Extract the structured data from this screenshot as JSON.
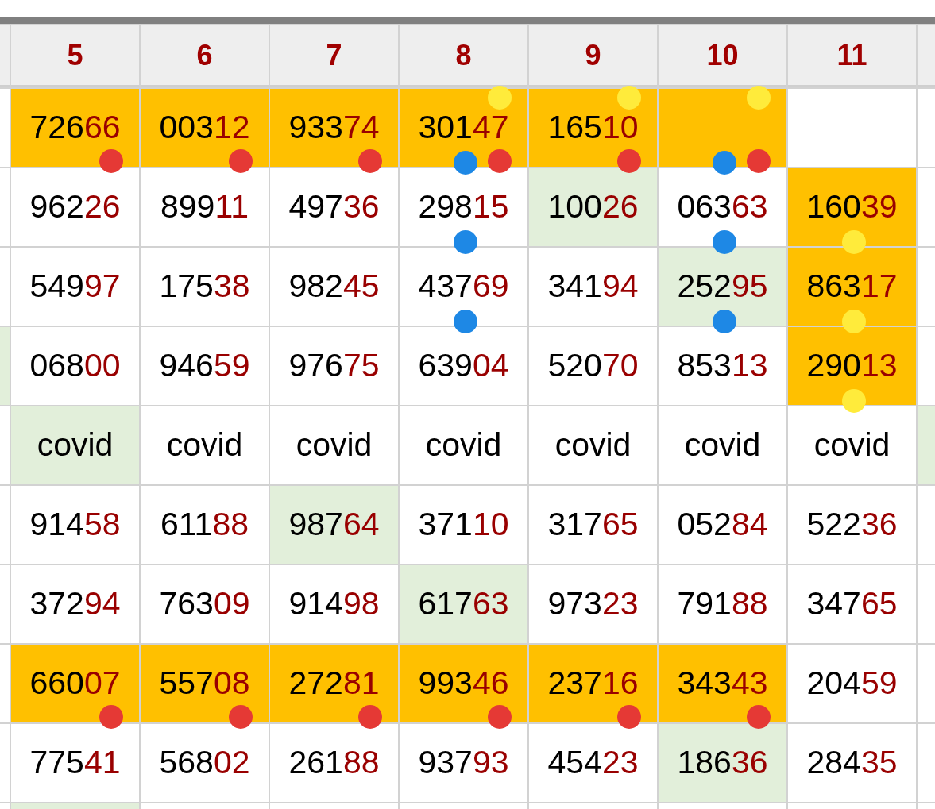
{
  "header": [
    {
      "label": "5"
    },
    {
      "label": "6"
    },
    {
      "label": "7"
    },
    {
      "label": "8"
    },
    {
      "label": "9"
    },
    {
      "label": "10"
    },
    {
      "label": "11"
    }
  ],
  "rows": [
    {
      "kind": "numbers",
      "cells": [
        {},
        {
          "text": "72666",
          "color": "#ffc000",
          "dots": [
            {
              "kind": "bottom-right",
              "color": "#e53935"
            }
          ]
        },
        {
          "text": "00312",
          "color": "#ffc000",
          "dots": [
            {
              "kind": "bottom-right",
              "color": "#e53935"
            }
          ]
        },
        {
          "text": "93374",
          "color": "#ffc000",
          "dots": [
            {
              "kind": "bottom-right",
              "color": "#e53935"
            }
          ]
        },
        {
          "text": "30147",
          "color": "#ffc000",
          "dots": [
            {
              "kind": "top-right",
              "color": "#ffeb3b"
            },
            {
              "kind": "bottom-center",
              "color": "#1e88e5"
            },
            {
              "kind": "bottom-right",
              "color": "#e53935"
            }
          ]
        },
        {
          "text": "16510",
          "color": "#ffc000",
          "dots": [
            {
              "kind": "top-right",
              "color": "#ffeb3b"
            },
            {
              "kind": "bottom-right",
              "color": "#e53935"
            }
          ]
        },
        {
          "color": "#ffc000",
          "dots": [
            {
              "kind": "top-right",
              "color": "#ffeb3b"
            },
            {
              "kind": "bottom-center",
              "color": "#1e88e5"
            },
            {
              "kind": "bottom-right",
              "color": "#e53935"
            }
          ]
        },
        {},
        {}
      ]
    },
    {
      "kind": "numbers",
      "cells": [
        {},
        {
          "text": "96226"
        },
        {
          "text": "89911"
        },
        {
          "text": "49736"
        },
        {
          "text": "29815",
          "dots": [
            {
              "kind": "bottom-center",
              "color": "#1e88e5"
            }
          ]
        },
        {
          "text": "10026",
          "color": "#e2efda"
        },
        {
          "text": "06363",
          "dots": [
            {
              "kind": "bottom-center",
              "color": "#1e88e5"
            }
          ]
        },
        {
          "text": "16039",
          "color": "#ffc000",
          "dots": [
            {
              "kind": "bottom-center",
              "color": "#ffeb3b"
            }
          ]
        },
        {}
      ]
    },
    {
      "kind": "numbers",
      "cells": [
        {},
        {
          "text": "54997"
        },
        {
          "text": "17538"
        },
        {
          "text": "98245"
        },
        {
          "text": "43769",
          "dots": [
            {
              "kind": "bottom-center",
              "color": "#1e88e5"
            }
          ]
        },
        {
          "text": "34194"
        },
        {
          "text": "25295",
          "color": "#e2efda",
          "dots": [
            {
              "kind": "bottom-center",
              "color": "#1e88e5"
            }
          ]
        },
        {
          "text": "86317",
          "color": "#ffc000",
          "dots": [
            {
              "kind": "bottom-center",
              "color": "#ffeb3b"
            }
          ]
        },
        {}
      ]
    },
    {
      "kind": "numbers",
      "cells": [
        {
          "color": "#e2efda"
        },
        {
          "text": "06800"
        },
        {
          "text": "94659"
        },
        {
          "text": "97675"
        },
        {
          "text": "63904"
        },
        {
          "text": "52070"
        },
        {
          "text": "85313"
        },
        {
          "text": "29013",
          "color": "#ffc000",
          "dots": [
            {
              "kind": "bottom-center",
              "color": "#ffeb3b"
            }
          ]
        },
        {}
      ]
    },
    {
      "kind": "words",
      "cells": [
        {},
        {
          "text": "covid",
          "color": "#e2efda"
        },
        {
          "text": "covid"
        },
        {
          "text": "covid"
        },
        {
          "text": "covid"
        },
        {
          "text": "covid"
        },
        {
          "text": "covid"
        },
        {
          "text": "covid"
        },
        {
          "color": "#e2efda"
        }
      ]
    },
    {
      "kind": "numbers",
      "cells": [
        {},
        {
          "text": "91458"
        },
        {
          "text": "61188"
        },
        {
          "text": "98764",
          "color": "#e2efda"
        },
        {
          "text": "37110"
        },
        {
          "text": "31765"
        },
        {
          "text": "05284"
        },
        {
          "text": "52236"
        },
        {}
      ]
    },
    {
      "kind": "numbers",
      "cells": [
        {},
        {
          "text": "37294"
        },
        {
          "text": "76309"
        },
        {
          "text": "91498"
        },
        {
          "text": "61763",
          "color": "#e2efda"
        },
        {
          "text": "97323"
        },
        {
          "text": "79188"
        },
        {
          "text": "34765"
        },
        {}
      ]
    },
    {
      "kind": "numbers",
      "cells": [
        {},
        {
          "text": "66007",
          "color": "#ffc000",
          "dots": [
            {
              "kind": "bottom-right",
              "color": "#e53935"
            }
          ]
        },
        {
          "text": "55708",
          "color": "#ffc000",
          "dots": [
            {
              "kind": "bottom-right",
              "color": "#e53935"
            }
          ]
        },
        {
          "text": "27281",
          "color": "#ffc000",
          "dots": [
            {
              "kind": "bottom-right",
              "color": "#e53935"
            }
          ]
        },
        {
          "text": "99346",
          "color": "#ffc000",
          "dots": [
            {
              "kind": "bottom-right",
              "color": "#e53935"
            }
          ]
        },
        {
          "text": "23716",
          "color": "#ffc000",
          "dots": [
            {
              "kind": "bottom-right",
              "color": "#e53935"
            }
          ]
        },
        {
          "text": "34343",
          "color": "#ffc000",
          "dots": [
            {
              "kind": "bottom-right",
              "color": "#e53935"
            }
          ]
        },
        {
          "text": "20459"
        },
        {}
      ]
    },
    {
      "kind": "numbers",
      "cells": [
        {},
        {
          "text": "77541"
        },
        {
          "text": "56802"
        },
        {
          "text": "26188"
        },
        {
          "text": "93793"
        },
        {
          "text": "45423"
        },
        {
          "text": "18636",
          "color": "#e2efda"
        },
        {
          "text": "28435"
        },
        {}
      ]
    },
    {
      "cells": [
        {},
        {
          "color": "#e2efda"
        },
        {},
        {},
        {},
        {},
        {},
        {},
        {}
      ]
    }
  ]
}
